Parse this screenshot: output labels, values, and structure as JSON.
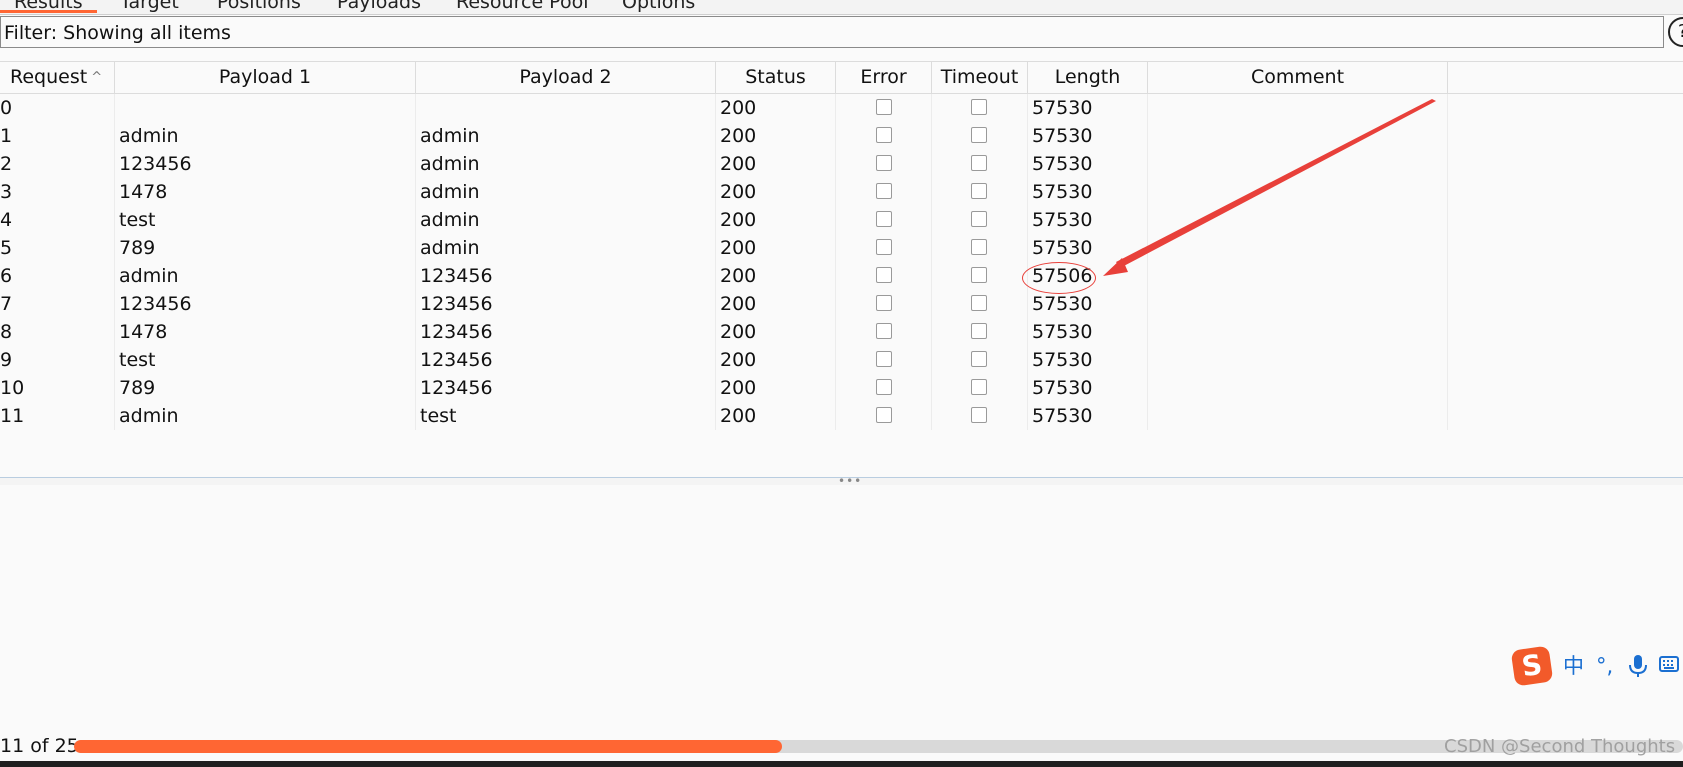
{
  "tabs": [
    {
      "label": "Results"
    },
    {
      "label": "Target"
    },
    {
      "label": "Positions"
    },
    {
      "label": "Payloads"
    },
    {
      "label": "Resource Pool"
    },
    {
      "label": "Options"
    }
  ],
  "filter": {
    "text": "Filter: Showing all items",
    "help_icon": "?"
  },
  "columns": [
    "Request",
    "Payload 1",
    "Payload 2",
    "Status",
    "Error",
    "Timeout",
    "Length",
    "Comment"
  ],
  "sort_indicator": "^",
  "rows": [
    {
      "request": "0",
      "payload1": "",
      "payload2": "",
      "status": "200",
      "length": "57530",
      "comment": ""
    },
    {
      "request": "1",
      "payload1": "admin",
      "payload2": "admin",
      "status": "200",
      "length": "57530",
      "comment": ""
    },
    {
      "request": "2",
      "payload1": "123456",
      "payload2": "admin",
      "status": "200",
      "length": "57530",
      "comment": ""
    },
    {
      "request": "3",
      "payload1": "1478",
      "payload2": "admin",
      "status": "200",
      "length": "57530",
      "comment": ""
    },
    {
      "request": "4",
      "payload1": "test",
      "payload2": "admin",
      "status": "200",
      "length": "57530",
      "comment": ""
    },
    {
      "request": "5",
      "payload1": "789",
      "payload2": "admin",
      "status": "200",
      "length": "57530",
      "comment": ""
    },
    {
      "request": "6",
      "payload1": "admin",
      "payload2": "123456",
      "status": "200",
      "length": "57506",
      "comment": ""
    },
    {
      "request": "7",
      "payload1": "123456",
      "payload2": "123456",
      "status": "200",
      "length": "57530",
      "comment": ""
    },
    {
      "request": "8",
      "payload1": "1478",
      "payload2": "123456",
      "status": "200",
      "length": "57530",
      "comment": ""
    },
    {
      "request": "9",
      "payload1": "test",
      "payload2": "123456",
      "status": "200",
      "length": "57530",
      "comment": ""
    },
    {
      "request": "10",
      "payload1": "789",
      "payload2": "123456",
      "status": "200",
      "length": "57530",
      "comment": ""
    },
    {
      "request": "11",
      "payload1": "admin",
      "payload2": "test",
      "status": "200",
      "length": "57530",
      "comment": ""
    }
  ],
  "progress": {
    "text": "11 of 25",
    "fraction": 0.44
  },
  "ime": {
    "logo": "S",
    "lang": "中",
    "punct": "°,",
    "mic_icon": "microphone-icon",
    "keyboard_icon": "keyboard-icon"
  },
  "watermark": "CSDN @Second Thoughts",
  "colors": {
    "accent": "#ff6633",
    "annotation": "#e8403a",
    "ime_blue": "#1b6fd1"
  }
}
